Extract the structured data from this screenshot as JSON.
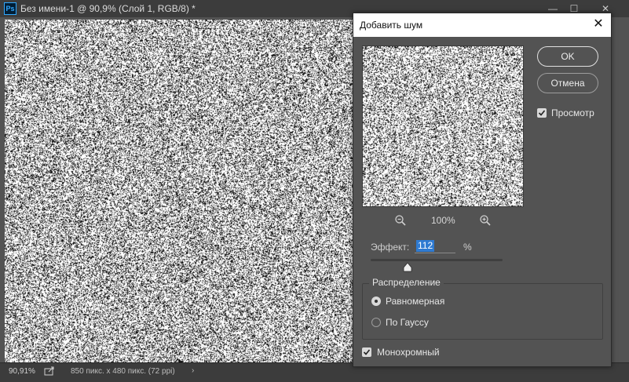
{
  "document": {
    "app_badge": "Ps",
    "title": "Без имени-1 @ 90,9% (Слой 1, RGB/8) *",
    "window_buttons": {
      "minimize": "—",
      "maximize": "☐",
      "close": "✕"
    }
  },
  "status_bar": {
    "zoom": "90,91%",
    "doc_info": "850 пикс. x 480 пикс. (72 ppi)",
    "arrow": "›"
  },
  "dialog": {
    "title": "Добавить шум",
    "close_glyph": "✕",
    "ok_label": "OK",
    "cancel_label": "Отмена",
    "preview_label": "Просмотр",
    "preview_checked": true,
    "zoom_level": "100%",
    "effect_label": "Эффект:",
    "effect_value": "112",
    "effect_unit": "%",
    "effect_slider_fraction": 0.28,
    "distribution_title": "Распределение",
    "distribution_options": [
      {
        "label": "Равномерная",
        "selected": true
      },
      {
        "label": "По Гауссу",
        "selected": false
      }
    ],
    "monochrome_label": "Монохромный",
    "monochrome_checked": true
  },
  "colors": {
    "accent": "#31a8ff",
    "selection": "#2f7bd2",
    "panel": "#535353",
    "titlebar": "#3c3c3c"
  },
  "icons": [
    "photoshop-logo-icon",
    "zoom-out-icon",
    "zoom-in-icon",
    "export-icon",
    "checkmark-icon",
    "slider-thumb-icon"
  ]
}
